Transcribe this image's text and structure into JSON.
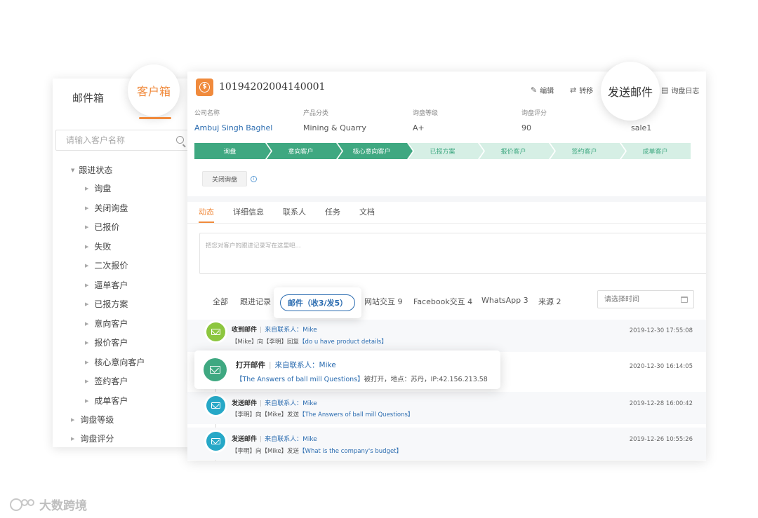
{
  "sidebar": {
    "tab_mailbox": "邮件箱",
    "tab_customer": "客户箱",
    "search_placeholder": "请输入客户名称",
    "tree_root": "跟进状态",
    "tree_children": [
      "询盘",
      "关闭询盘",
      "已报价",
      "失败",
      "二次报价",
      "逼单客户",
      "已报方案",
      "意向客户",
      "报价客户",
      "核心意向客户",
      "签约客户",
      "成单客户"
    ],
    "tree_bottom": [
      "询盘等级",
      "询盘评分"
    ]
  },
  "header": {
    "customer_id": "10194202004140001",
    "actions": {
      "edit": "编辑",
      "transfer": "转移",
      "send_mail": "发送邮件",
      "inquiry_log": "询盘日志"
    }
  },
  "fields": {
    "labels": [
      "公司名称",
      "产品分类",
      "询盘等级",
      "询盘评分"
    ],
    "values": [
      "Ambuj Singh Baghel",
      "Mining & Quarry",
      "A+",
      "90",
      "sale1"
    ]
  },
  "stages": {
    "items": [
      "询盘",
      "意向客户",
      "核心意向客户",
      "已报方案",
      "报价客户",
      "签约客户",
      "成单客户"
    ],
    "completed_count": 3,
    "colors": {
      "done": "#3fa881",
      "todo": "#d6efe5"
    }
  },
  "close_inquiry": "关闭询盘",
  "tabs": [
    "动态",
    "详细信息",
    "联系人",
    "任务",
    "文档"
  ],
  "note_placeholder": "把您对客户的跟进记录写在这里吧...",
  "filters": {
    "items": [
      "全部",
      "跟进记录",
      "邮件（收3/发5）",
      "网站交互 9",
      "Facebook交互 4",
      "WhatsApp 3",
      "来源 2"
    ],
    "date_placeholder": "请选择时间"
  },
  "feed": [
    {
      "title": "收到邮件",
      "from": "来自联系人：Mike",
      "desc_prefix": "【Mike】向【李明】回复",
      "desc_link": "【do u have product details】",
      "desc_suffix": "",
      "time": "2019-12-30  17:55:08",
      "icon": "envelope-open-icon",
      "color": "#8cc63f"
    },
    {
      "title": "打开邮件",
      "from": "来自联系人：Mike",
      "desc_prefix": "",
      "desc_link": "【The Answers of ball mill Questions】",
      "desc_suffix": "被打开，地点：苏丹，IP:42.156.213.58",
      "time": "2020-12-30  16:14:05",
      "icon": "envelope-icon",
      "color": "#3fa881"
    },
    {
      "title": "发送邮件",
      "from": "来自联系人：Mike",
      "desc_prefix": "【李明】向【Mike】发送",
      "desc_link": "【The Answers of ball mill Questions】",
      "desc_suffix": "",
      "time": "2019-12-28  16:00:42",
      "icon": "envelope-send-icon",
      "color": "#26a8c7"
    },
    {
      "title": "发送邮件",
      "from": "来自联系人：Mike",
      "desc_prefix": "【李明】向【Mike】发送",
      "desc_link": "【What is the company's budget】",
      "desc_suffix": "",
      "time": "2019-12-26  10:55:26",
      "icon": "envelope-send-icon",
      "color": "#26a8c7"
    }
  ],
  "watermark": "大数跨境",
  "accent": "#f08a3c"
}
